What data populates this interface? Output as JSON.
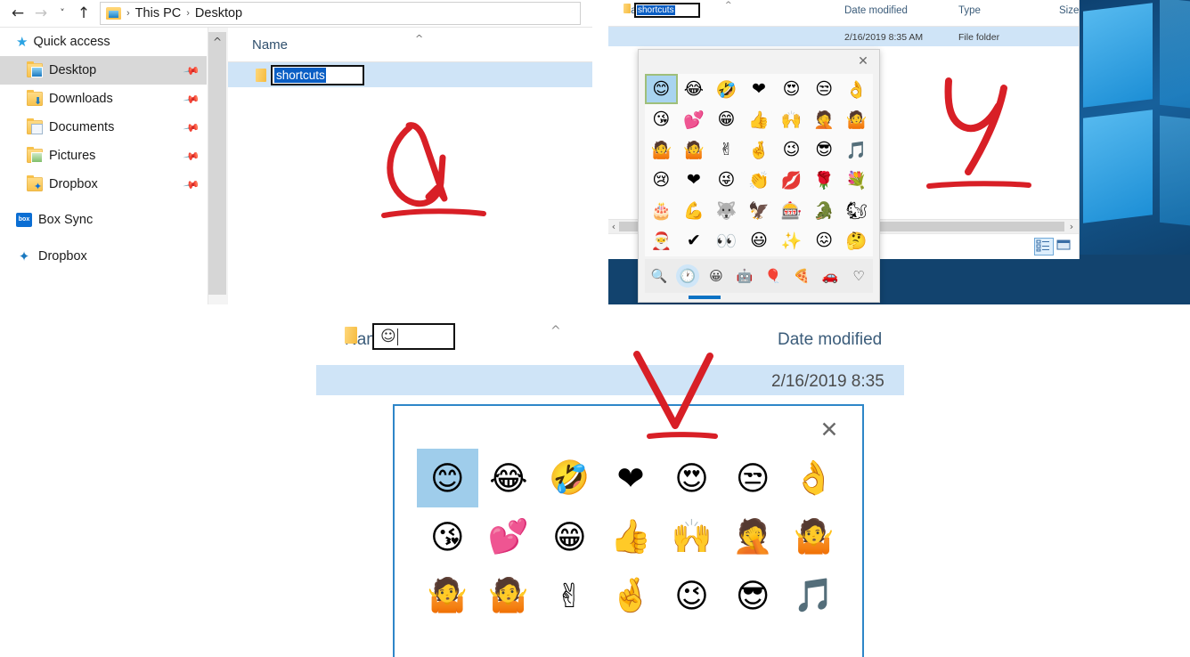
{
  "panel_top_left": {
    "name": "explorer-window-renaming-folder",
    "nav": {
      "back_icon": "←",
      "forward_icon": "→",
      "recent_icon": "˅",
      "up_icon": "↑",
      "breadcrumb": [
        "This PC",
        "Desktop"
      ],
      "separator": "›"
    },
    "sidebar": {
      "header": {
        "label": "Quick access",
        "icon": "star-icon",
        "glyph": "★"
      },
      "items": [
        {
          "label": "Desktop",
          "icon": "folder-desktop-icon",
          "pinned": true,
          "selected": true
        },
        {
          "label": "Downloads",
          "icon": "folder-downloads-icon",
          "pinned": true,
          "selected": false
        },
        {
          "label": "Documents",
          "icon": "folder-documents-icon",
          "pinned": true,
          "selected": false
        },
        {
          "label": "Pictures",
          "icon": "folder-pictures-icon",
          "pinned": true,
          "selected": false
        },
        {
          "label": "Dropbox",
          "icon": "folder-dropbox-icon",
          "pinned": true,
          "selected": false
        }
      ],
      "roots": [
        {
          "label": "Box Sync",
          "icon": "box-sync-logo-icon",
          "glyph": "box"
        },
        {
          "label": "Dropbox",
          "icon": "dropbox-logo-icon",
          "glyph": "✦"
        }
      ],
      "pin_glyph": "📌"
    },
    "file_list": {
      "column_header": "Name",
      "sort_caret": "^",
      "row": {
        "rename_value": "shortcuts",
        "icon": "folder-icon"
      }
    }
  },
  "panel_top_right": {
    "name": "explorer-with-emoji-picker",
    "columns": [
      "Name",
      "Date modified",
      "Type",
      "Size"
    ],
    "sort_caret": "^",
    "row": {
      "rename_value": "shortcuts",
      "date_modified": "2/16/2019 8:35 AM",
      "type": "File folder",
      "size": ""
    },
    "scrollbar": {
      "left_arrow": "‹",
      "right_arrow": "›"
    },
    "status_bar": {
      "view_details_icon": "details-view-icon",
      "view_large_icon": "large-icons-view-icon"
    },
    "emoji_picker": {
      "close_icon": "✕",
      "selected_index": 0,
      "grid": [
        "😊",
        "😂",
        "🤣",
        "❤",
        "😍",
        "😒",
        "👌",
        "😘",
        "💕",
        "😁",
        "👍",
        "🙌",
        "🤦",
        "🤷",
        "🤷",
        "🤷",
        "✌",
        "🤞",
        "😉",
        "😎",
        "🎵",
        "😢",
        "❤",
        "😜",
        "👏",
        "💋",
        "🌹",
        "💐",
        "🎂",
        "💪",
        "🐺",
        "🦅",
        "🎰",
        "🐊",
        "🐿",
        "🎅",
        "✔",
        "👀",
        "😃",
        "✨",
        "😖",
        "🤔"
      ],
      "tabs": [
        {
          "icon": "search-icon",
          "glyph": "🔍",
          "active": false
        },
        {
          "icon": "recent-clock-icon",
          "glyph": "🕐",
          "active": true
        },
        {
          "icon": "smiley-icon",
          "glyph": "😀",
          "active": false
        },
        {
          "icon": "kaomoji-icon",
          "glyph": "🤖",
          "active": false
        },
        {
          "icon": "balloon-icon",
          "glyph": "🎈",
          "active": false
        },
        {
          "icon": "food-pizza-icon",
          "glyph": "🍕",
          "active": false
        },
        {
          "icon": "vehicle-icon",
          "glyph": "🚗",
          "active": false
        },
        {
          "icon": "symbols-heart-icon",
          "glyph": "♡",
          "active": false
        }
      ]
    }
  },
  "panel_bottom": {
    "name": "zoomed-explorer-with-emoji-picker",
    "columns": [
      "Name",
      "Date modified"
    ],
    "sort_caret": "^",
    "row": {
      "rename_glyph": "☺",
      "date_modified": "2/16/2019 8:35"
    },
    "emoji_picker": {
      "close_icon": "✕",
      "selected_index": 0,
      "grid": [
        "😊",
        "😂",
        "🤣",
        "❤",
        "😍",
        "😒",
        "👌",
        "😘",
        "💕",
        "😁",
        "👍",
        "🙌",
        "🤦",
        "🤷",
        "🤷",
        "🤷",
        "✌",
        "🤞",
        "😉",
        "😎",
        "🎵"
      ]
    }
  },
  "annotations": [
    {
      "name": "ink-letter-a",
      "shape": "handwritten letter a with underline",
      "color": "#d81f26"
    },
    {
      "name": "ink-letter-y",
      "shape": "handwritten letter y with underline",
      "color": "#d81f26"
    },
    {
      "name": "ink-check-v",
      "shape": "handwritten V with underline",
      "color": "#d81f26"
    }
  ],
  "colors": {
    "selection_blue": "#cfe4f7",
    "text_select_blue": "#0a5ec4",
    "accent_blue": "#2e86c8",
    "ink_red": "#d81f26",
    "header_text": "#3b5c7a",
    "desktop_blue": "#12436e"
  }
}
